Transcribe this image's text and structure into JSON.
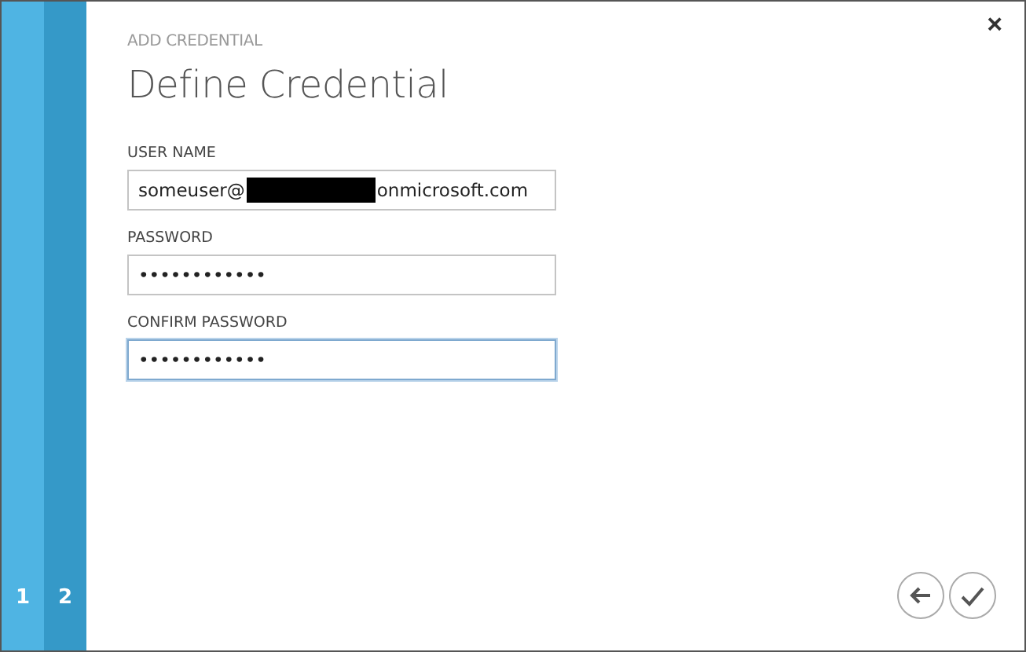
{
  "steps": [
    {
      "label": "1",
      "selected": false
    },
    {
      "label": "2",
      "selected": true
    }
  ],
  "close": {
    "glyph": "×"
  },
  "dialog": {
    "subtitle": "ADD CREDENTIAL",
    "title": "Define Credential"
  },
  "fields": [
    {
      "label": "USER NAME",
      "kind": "redacted",
      "value_before": "someuser@",
      "value_after": "onmicrosoft.com",
      "focused": false
    },
    {
      "label": "PASSWORD",
      "kind": "password",
      "value": "••••••••••••",
      "focused": false
    },
    {
      "label": "CONFIRM PASSWORD",
      "kind": "password",
      "value": "••••••••••••",
      "focused": true
    }
  ],
  "actions": [
    {
      "kind": "back"
    },
    {
      "kind": "confirm"
    }
  ]
}
